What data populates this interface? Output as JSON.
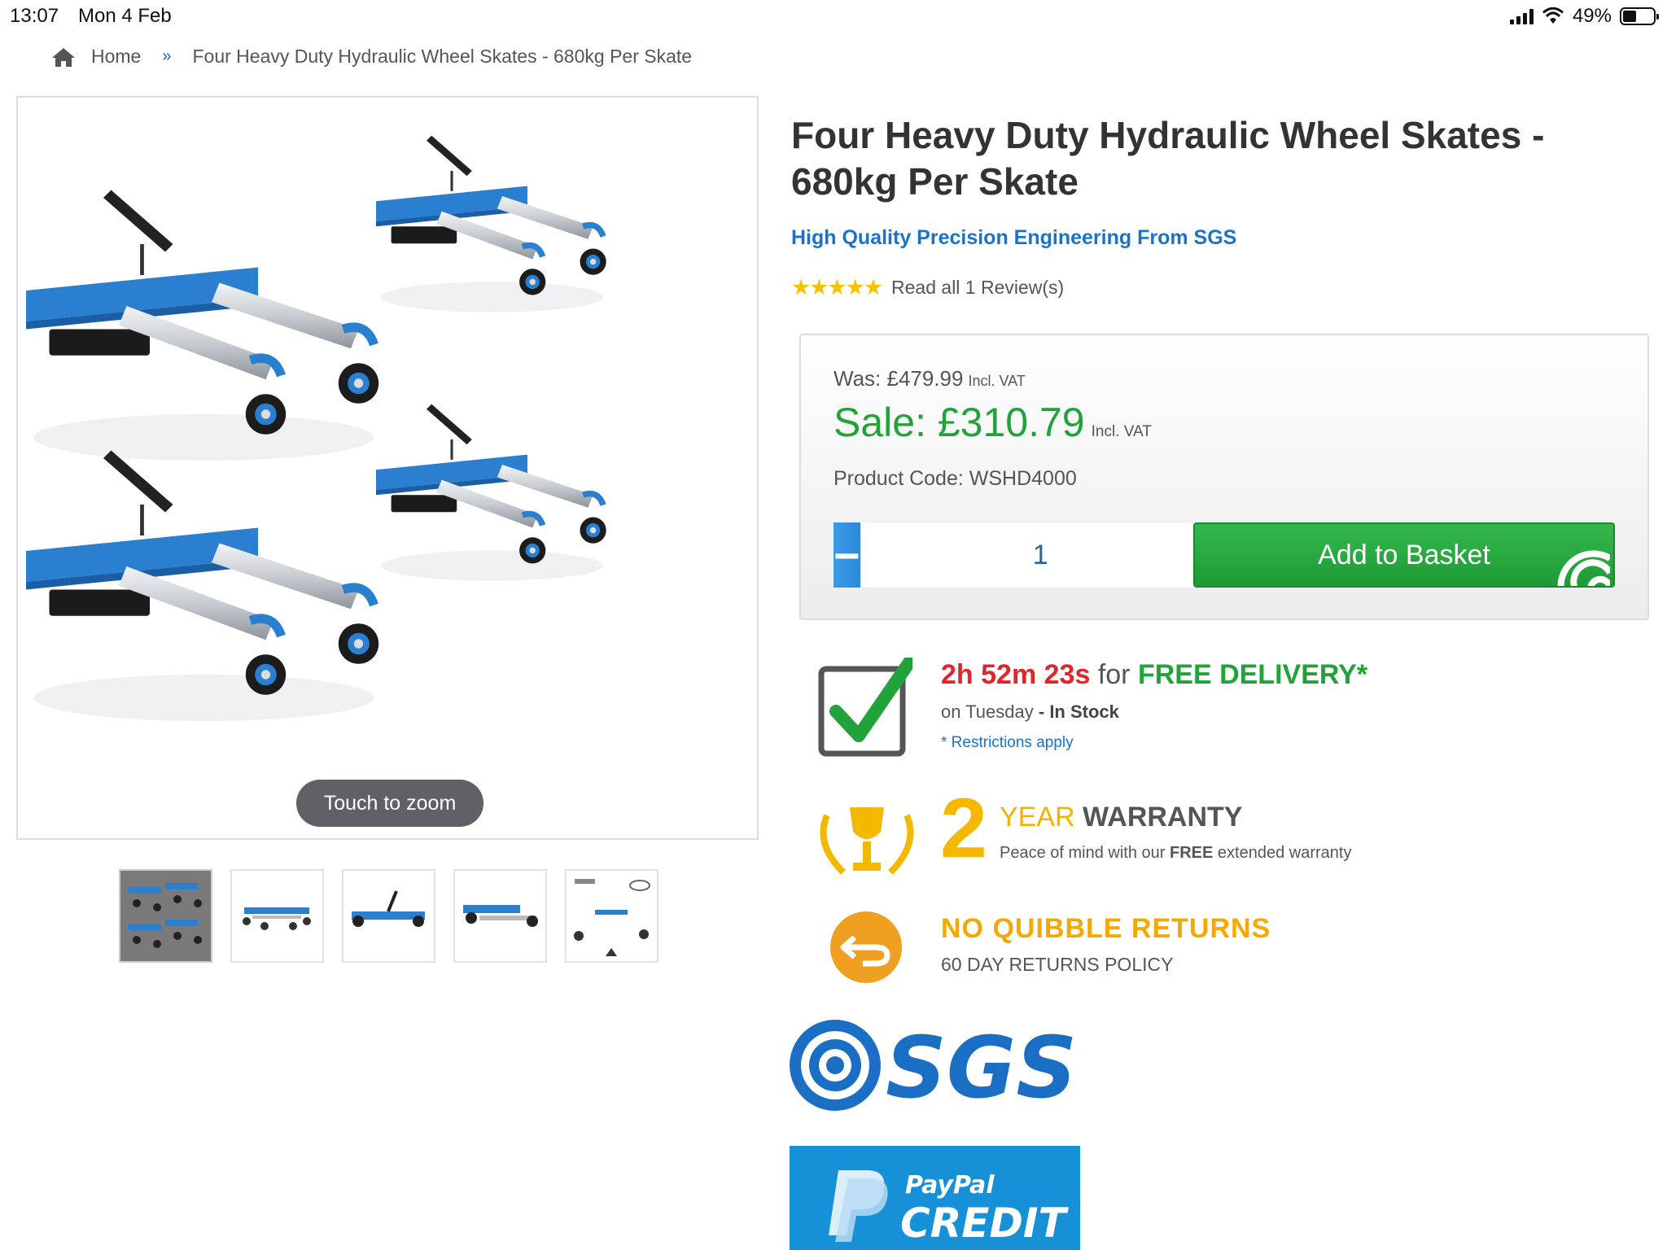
{
  "status_bar": {
    "time": "13:07",
    "date": "Mon 4 Feb",
    "battery": "49%"
  },
  "breadcrumb": {
    "home": "Home",
    "separator": "»",
    "current": "Four Heavy Duty Hydraulic Wheel Skates - 680kg Per Skate"
  },
  "gallery": {
    "zoom_hint": "Touch to zoom",
    "thumbnail_count": 5,
    "active_thumbnail": 1
  },
  "product": {
    "title": "Four Heavy Duty Hydraulic Wheel Skates - 680kg Per Skate",
    "subtitle": "High Quality Precision Engineering From SGS",
    "stars": "★★★★★",
    "rating": 5,
    "reviews_link": "Read all 1 Review(s)"
  },
  "pricing": {
    "was_label": "Was: £479.99",
    "was_vat": "Incl. VAT",
    "sale_label": "Sale: £310.79",
    "sale_vat": "Incl. VAT",
    "product_code": "Product Code: WSHD4000",
    "quantity": "1",
    "minus": "−",
    "plus": "+",
    "add_to_basket": "Add to Basket"
  },
  "delivery": {
    "timer": "2h 52m 23s",
    "for": "for",
    "free": "FREE DELIVERY*",
    "day": "on Tuesday",
    "stock": "- In Stock",
    "restrictions": "* Restrictions apply"
  },
  "warranty": {
    "number": "2",
    "year": "YEAR",
    "word": "WARRANTY",
    "sub_before": "Peace of mind with our ",
    "sub_bold": "FREE",
    "sub_after": " extended warranty"
  },
  "returns": {
    "title": "NO QUIBBLE RETURNS",
    "sub": "60 DAY RETURNS POLICY"
  },
  "logos": {
    "brand": "SGS",
    "paypal_top": "PayPal",
    "paypal_bottom": "CREDIT"
  },
  "colors": {
    "sale_green": "#22a23a",
    "link_blue": "#1a73c7",
    "timer_red": "#e0262c",
    "gold": "#f5b800",
    "product_blue": "#2b7fd0"
  }
}
